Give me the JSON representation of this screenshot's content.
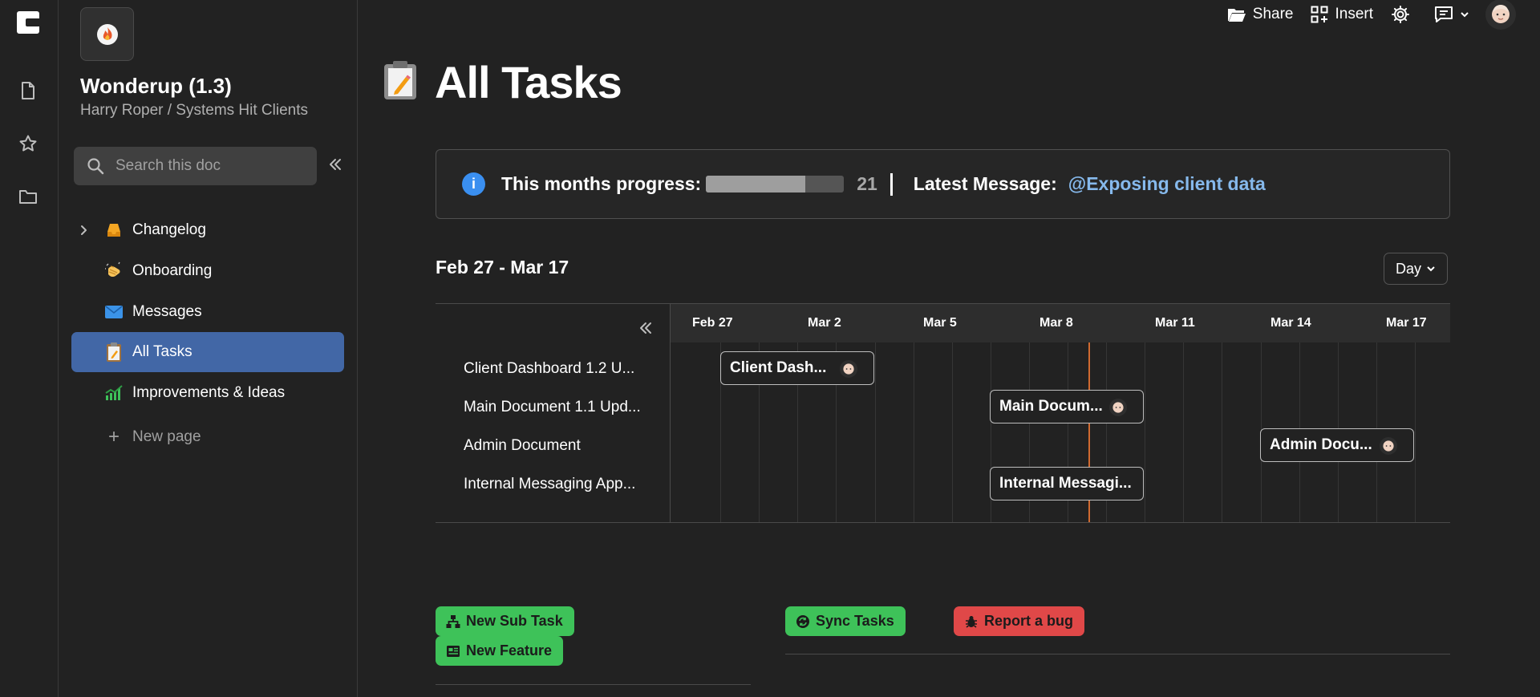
{
  "rail": {
    "icons": [
      "coda-logo-icon",
      "doc-icon",
      "star-icon",
      "folder-icon"
    ]
  },
  "sidebar": {
    "doc_title": "Wonderup (1.3)",
    "doc_path": "Harry Roper / Systems Hit Clients",
    "search_placeholder": "Search this doc",
    "items": [
      {
        "label": "Changelog",
        "icon": "inbox-tray-icon",
        "expandable": true,
        "active": false
      },
      {
        "label": "Onboarding",
        "icon": "waving-hand-icon",
        "expandable": false,
        "active": false
      },
      {
        "label": "Messages",
        "icon": "envelope-icon",
        "expandable": false,
        "active": false
      },
      {
        "label": "All Tasks",
        "icon": "clipboard-icon",
        "expandable": false,
        "active": true
      },
      {
        "label": "Improvements & Ideas",
        "icon": "chart-increasing-icon",
        "expandable": false,
        "active": false
      }
    ],
    "new_page_label": "New page"
  },
  "toolbar": {
    "share_label": "Share",
    "insert_label": "Insert"
  },
  "page": {
    "title": "All Tasks",
    "title_icon": "clipboard-icon"
  },
  "banner": {
    "progress_label": "This months progress:",
    "progress_fraction": 0.72,
    "progress_value": "21",
    "message_label": "Latest Message:",
    "message_link": "@Exposing client data"
  },
  "timeline": {
    "range": "Feb 27 - Mar 17",
    "view": "Day",
    "dates": [
      "Feb 27",
      "Mar 2",
      "Mar 5",
      "Mar 8",
      "Mar 11",
      "Mar 14",
      "Mar 17"
    ],
    "tasks": [
      {
        "name": "Client Dashboard 1.2 U...",
        "bar_label": "Client Dash...",
        "has_avatar": true
      },
      {
        "name": "Main Document 1.1 Upd...",
        "bar_label": "Main Docum...",
        "has_avatar": true
      },
      {
        "name": "Admin Document",
        "bar_label": "Admin Docu...",
        "has_avatar": true
      },
      {
        "name": "Internal Messaging App...",
        "bar_label": "Internal Messagi...",
        "has_avatar": false
      }
    ]
  },
  "actions": {
    "new_sub_task": "New Sub Task",
    "new_feature": "New Feature",
    "sync_tasks": "Sync Tasks",
    "report_bug": "Report a bug"
  },
  "colors": {
    "accent_active": "#4267a6",
    "green": "#3ec259",
    "red": "#e04848",
    "link": "#86b9ec",
    "today_line": "#d06a30"
  }
}
